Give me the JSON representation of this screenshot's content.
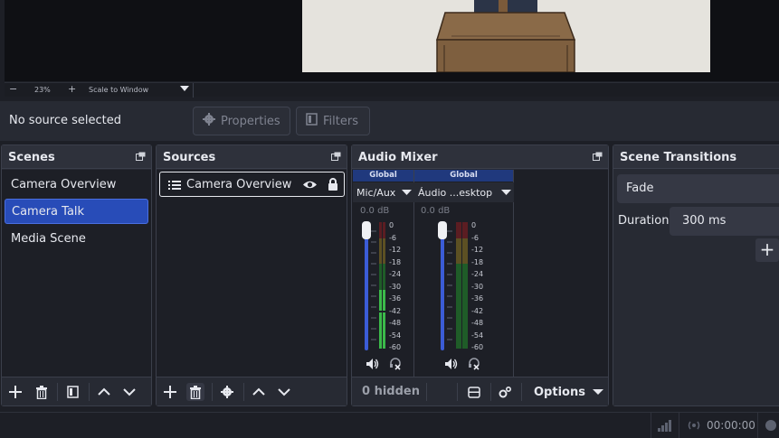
{
  "zoom": {
    "zoom_out": "−",
    "percent": "23%",
    "zoom_in": "+",
    "scale_mode": "Scale to Window"
  },
  "context": {
    "no_source": "No source selected",
    "properties": "Properties",
    "filters": "Filters"
  },
  "scenes": {
    "title": "Scenes",
    "items": [
      "Camera Overview",
      "Camera Talk",
      "Media Scene"
    ],
    "selected_index": 1
  },
  "sources": {
    "title": "Sources",
    "items": [
      {
        "label": "Camera Overview",
        "visible": true,
        "locked": true
      }
    ]
  },
  "mixer": {
    "title": "Audio Mixer",
    "channels": [
      {
        "tag": "Global",
        "name": "Mic/Aux",
        "db": "0.0 dB",
        "volume": 1.0,
        "meter_level": 0.55
      },
      {
        "tag": "Global",
        "name": "Áudio ...esktop",
        "db": "0.0 dB",
        "volume": 1.0,
        "meter_level": 0.0
      }
    ],
    "ticks": [
      "0",
      "-6",
      "-12",
      "-18",
      "-24",
      "-30",
      "-36",
      "-42",
      "-48",
      "-54",
      "-60"
    ],
    "hidden_label": "0 hidden",
    "options_label": "Options"
  },
  "transitions": {
    "title": "Scene Transitions",
    "type": "Fade",
    "duration_label": "Duration",
    "duration_value": "300 ms",
    "add_symbol": "+"
  },
  "status": {
    "time": "00:00:00"
  },
  "colors": {
    "accent": "#284cb8",
    "meter_green": "#3bb94a",
    "meter_yellow": "#b9a13b",
    "meter_red": "#b9323b"
  }
}
